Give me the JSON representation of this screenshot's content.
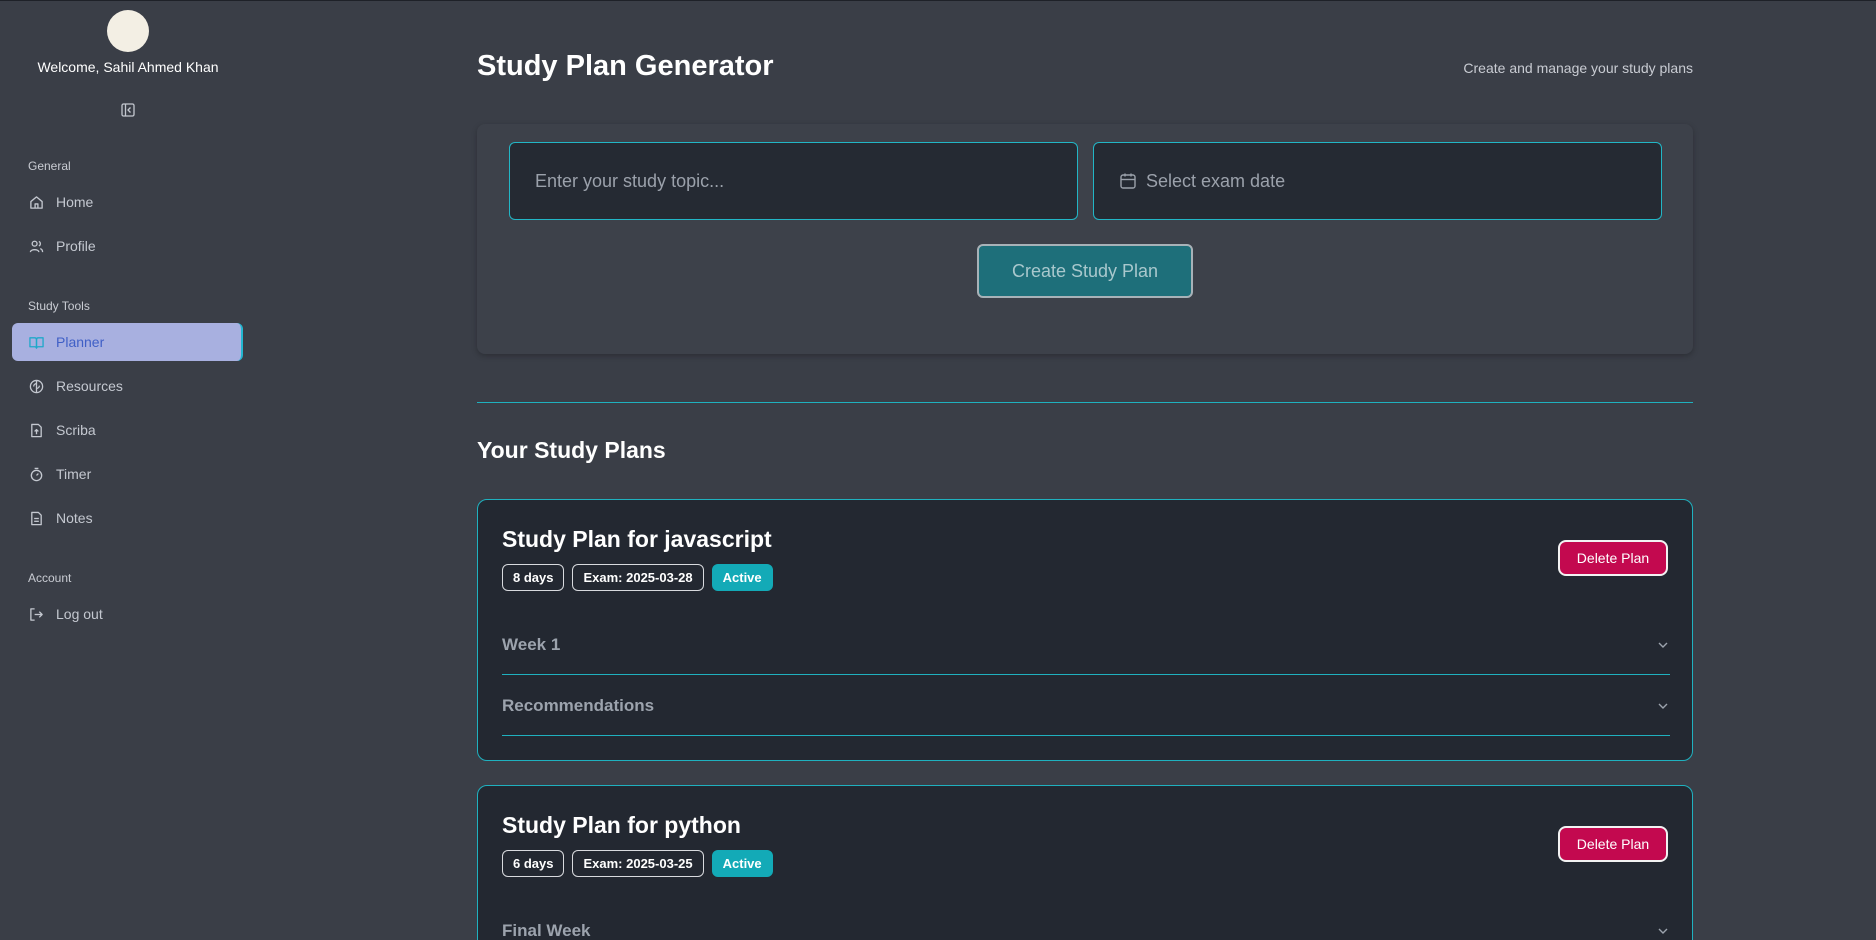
{
  "user": {
    "welcome": "Welcome, Sahil Ahmed Khan"
  },
  "sidebar": {
    "sections": [
      {
        "label": "General",
        "items": [
          {
            "label": "Home",
            "icon": "home-icon"
          },
          {
            "label": "Profile",
            "icon": "users-icon"
          }
        ]
      },
      {
        "label": "Study Tools",
        "items": [
          {
            "label": "Planner",
            "icon": "book-open-icon",
            "active": true
          },
          {
            "label": "Resources",
            "icon": "brain-icon"
          },
          {
            "label": "Scriba",
            "icon": "file-upload-icon"
          },
          {
            "label": "Timer",
            "icon": "timer-icon"
          },
          {
            "label": "Notes",
            "icon": "file-text-icon"
          }
        ]
      },
      {
        "label": "Account",
        "items": [
          {
            "label": "Log out",
            "icon": "log-out-icon"
          }
        ]
      }
    ]
  },
  "header": {
    "title": "Study Plan Generator",
    "subtitle": "Create and manage your study plans"
  },
  "form": {
    "topic_placeholder": "Enter your study topic...",
    "date_placeholder": "Select exam date",
    "create_label": "Create Study Plan"
  },
  "plans_section": {
    "title": "Your Study Plans"
  },
  "plans": [
    {
      "title": "Study Plan for javascript",
      "days": "8 days",
      "exam": "Exam: 2025-03-28",
      "status": "Active",
      "delete_label": "Delete Plan",
      "sections": [
        "Week 1",
        "Recommendations"
      ]
    },
    {
      "title": "Study Plan for python",
      "days": "6 days",
      "exam": "Exam: 2025-03-25",
      "status": "Active",
      "delete_label": "Delete Plan",
      "sections": [
        "Final Week"
      ]
    }
  ],
  "colors": {
    "accent": "#1fb1bf",
    "active_nav_bg": "#a8b0e0",
    "delete": "#c3094f",
    "background": "#3a3e47",
    "card": "#232831"
  }
}
